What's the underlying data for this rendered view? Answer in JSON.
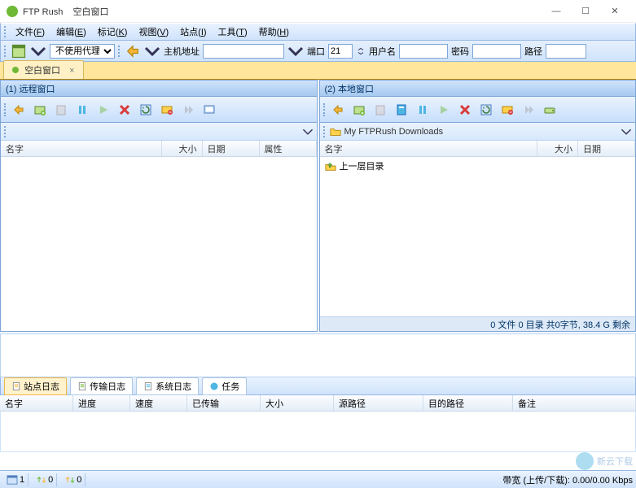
{
  "title": {
    "app": "FTP Rush",
    "window": "空白窗口"
  },
  "win": {
    "min": "—",
    "max": "☐",
    "close": "✕"
  },
  "menu": {
    "file": {
      "t": "文件",
      "h": "F"
    },
    "edit": {
      "t": "编辑",
      "h": "E"
    },
    "mark": {
      "t": "标记",
      "h": "K"
    },
    "view": {
      "t": "视图",
      "h": "V"
    },
    "site": {
      "t": "站点",
      "h": "I"
    },
    "tools": {
      "t": "工具",
      "h": "T"
    },
    "help": {
      "t": "帮助",
      "h": "H"
    }
  },
  "addr": {
    "proxy_options": [
      "不使用代理"
    ],
    "proxy": "不使用代理",
    "host_label": "主机地址",
    "host": "",
    "port_label": "端口",
    "port": "21",
    "user_label": "用户名",
    "user": "",
    "pass_label": "密码",
    "pass": "",
    "path_label": "路径",
    "path": ""
  },
  "session_tab": {
    "label": "空白窗口",
    "close": "×"
  },
  "panels": {
    "remote": {
      "title": "(1) 远程窗口",
      "path": "",
      "cols": {
        "name": "名字",
        "size": "大小",
        "date": "日期",
        "attr": "属性"
      },
      "status": ""
    },
    "local": {
      "title": "(2) 本地窗口",
      "path": "My FTPRush Downloads",
      "cols": {
        "name": "名字",
        "size": "大小",
        "date": "日期"
      },
      "rows": [
        {
          "name": "上一层目录"
        }
      ],
      "status": "0 文件 0 目录 共0字节, 38.4 G 剩余"
    }
  },
  "bottom_tabs": {
    "sitelog": "站点日志",
    "xferlog": "传输日志",
    "syslog": "系统日志",
    "tasks": "任务"
  },
  "queue_cols": {
    "name": "名字",
    "progress": "进度",
    "speed": "速度",
    "xferred": "已传输",
    "size": "大小",
    "src": "源路径",
    "dst": "目的路径",
    "remark": "备注"
  },
  "statusbar": {
    "windows_count": "1",
    "up_count": "0",
    "down_count": "0",
    "bandwidth_label": "带宽 (上传/下载):",
    "bandwidth_value": "0.00/0.00 Kbps"
  },
  "watermark": {
    "line1": "新云下载",
    "line2": ""
  }
}
